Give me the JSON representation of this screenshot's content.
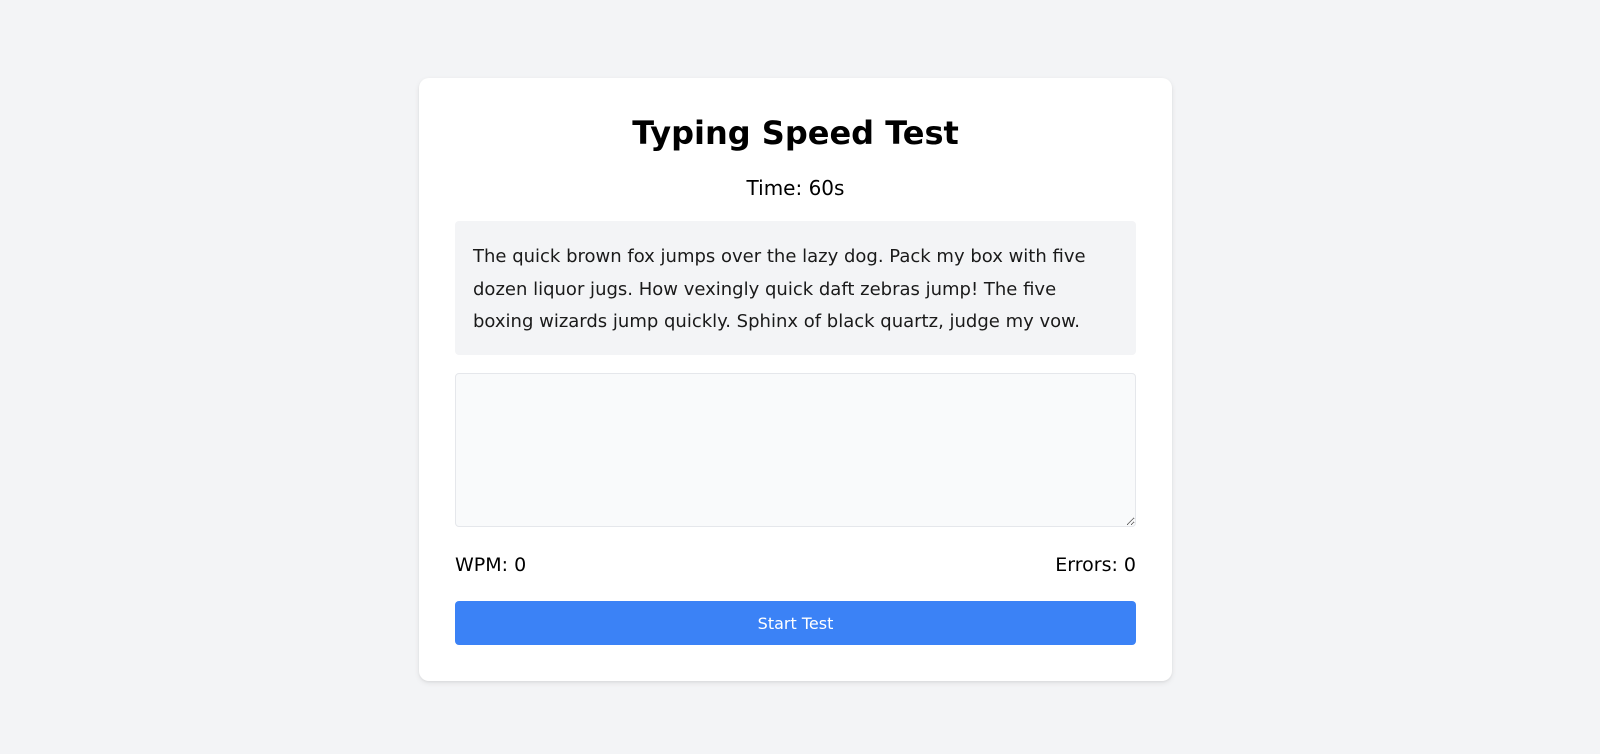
{
  "app": {
    "title": "Typing Speed Test"
  },
  "timer": {
    "text": "Time: 60s"
  },
  "passage": {
    "text": "The quick brown fox jumps over the lazy dog. Pack my box with five dozen liquor jugs. How vexingly quick daft zebras jump! The five boxing wizards jump quickly. Sphinx of black quartz, judge my vow."
  },
  "input": {
    "value": "",
    "placeholder": ""
  },
  "stats": {
    "wpm": "WPM: 0",
    "errors": "Errors: 0"
  },
  "actions": {
    "start_label": "Start Test"
  },
  "colors": {
    "background": "#f3f4f6",
    "card": "#ffffff",
    "accent": "#3b82f6"
  }
}
